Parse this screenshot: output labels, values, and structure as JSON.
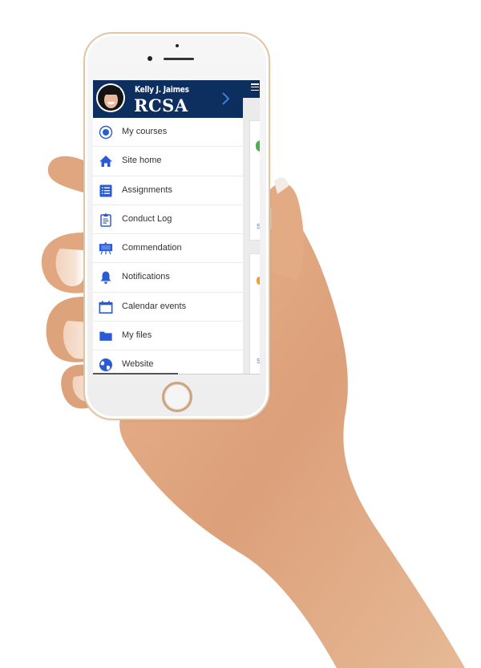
{
  "drawer": {
    "user_name": "Kelly J. Jaimes",
    "org_name": "RCSA",
    "chevron_icon": "chevron-right-icon",
    "items": [
      {
        "label": "My courses",
        "icon": "radio-target-icon"
      },
      {
        "label": "Site home",
        "icon": "home-icon"
      },
      {
        "label": "Assignments",
        "icon": "list-icon"
      },
      {
        "label": "Conduct Log",
        "icon": "clipboard-icon"
      },
      {
        "label": "Commendation",
        "icon": "easel-icon"
      },
      {
        "label": "Notifications",
        "icon": "bell-icon"
      },
      {
        "label": "Calendar events",
        "icon": "calendar-icon"
      },
      {
        "label": "My files",
        "icon": "folder-icon"
      },
      {
        "label": "Website",
        "icon": "globe-icon"
      }
    ]
  },
  "background_page": {
    "menu_icon": "hamburger-icon",
    "cards": [
      {
        "accent": "#4caf50",
        "link_text": "S"
      },
      {
        "accent": "#f0a030",
        "link_text": "S"
      }
    ]
  },
  "colors": {
    "header_bg": "#0d2f60",
    "icon_blue": "#2a5bd7",
    "chevron": "#3d8be6"
  }
}
